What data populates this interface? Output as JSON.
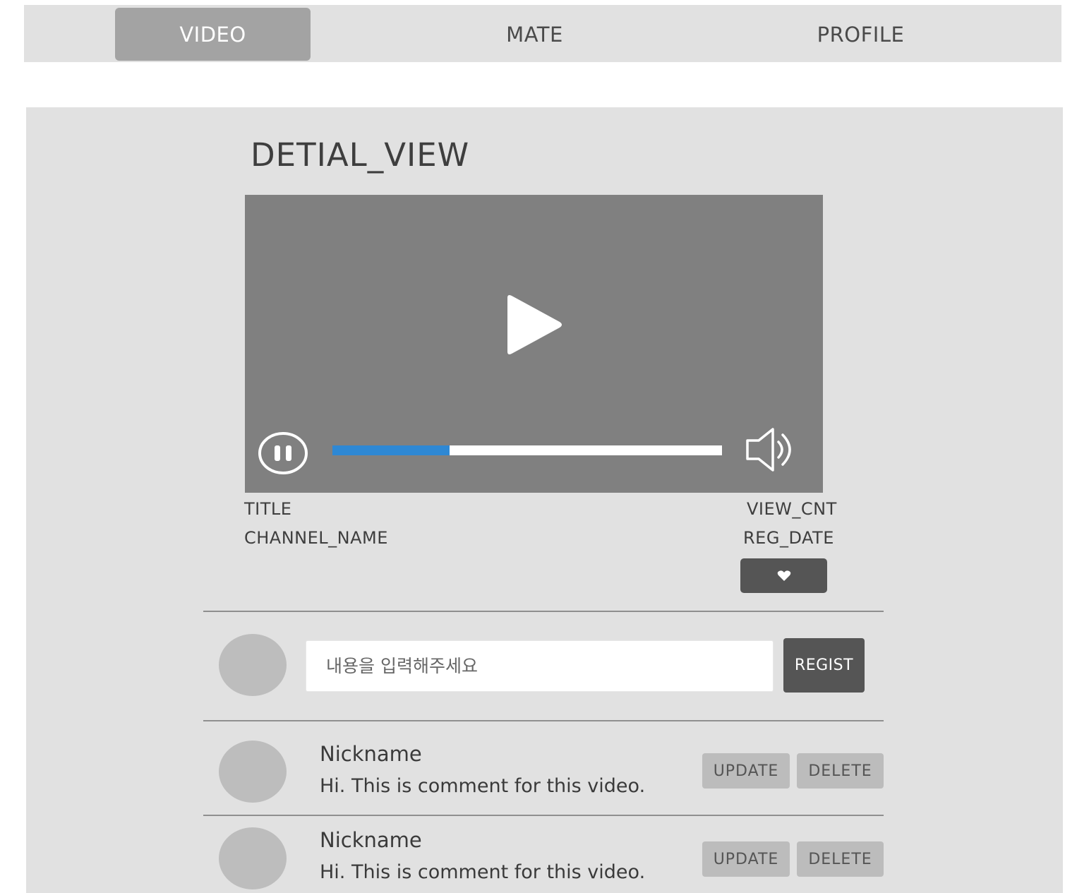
{
  "nav": {
    "tabs": [
      {
        "label": "VIDEO",
        "active": true
      },
      {
        "label": "MATE",
        "active": false
      },
      {
        "label": "PROFILE",
        "active": false
      }
    ]
  },
  "page": {
    "title": "DETIAL_VIEW"
  },
  "player": {
    "progress_fraction": 0.3,
    "progress_color": "#2e88d4",
    "play_icon": "play-icon",
    "pause_icon": "pause-icon",
    "volume_icon": "volume-icon"
  },
  "video_meta": {
    "title": "TITLE",
    "channel_name": "CHANNEL_NAME",
    "view_cnt": "VIEW_CNT",
    "reg_date": "REG_DATE",
    "like_icon": "heart-icon"
  },
  "comment_form": {
    "placeholder": "내용을 입력해주세요",
    "submit_label": "REGIST"
  },
  "comments": [
    {
      "nickname": "Nickname",
      "text": "Hi. This is comment for this video.",
      "update_label": "UPDATE",
      "delete_label": "DELETE"
    },
    {
      "nickname": "Nickname",
      "text": "Hi. This is comment for this video.",
      "update_label": "UPDATE",
      "delete_label": "DELETE"
    }
  ],
  "colors": {
    "panel_bg": "#e1e1e1",
    "active_tab": "#a3a3a3",
    "dark_button": "#555555",
    "avatar": "#bdbdbd",
    "player_bg": "#808080"
  }
}
